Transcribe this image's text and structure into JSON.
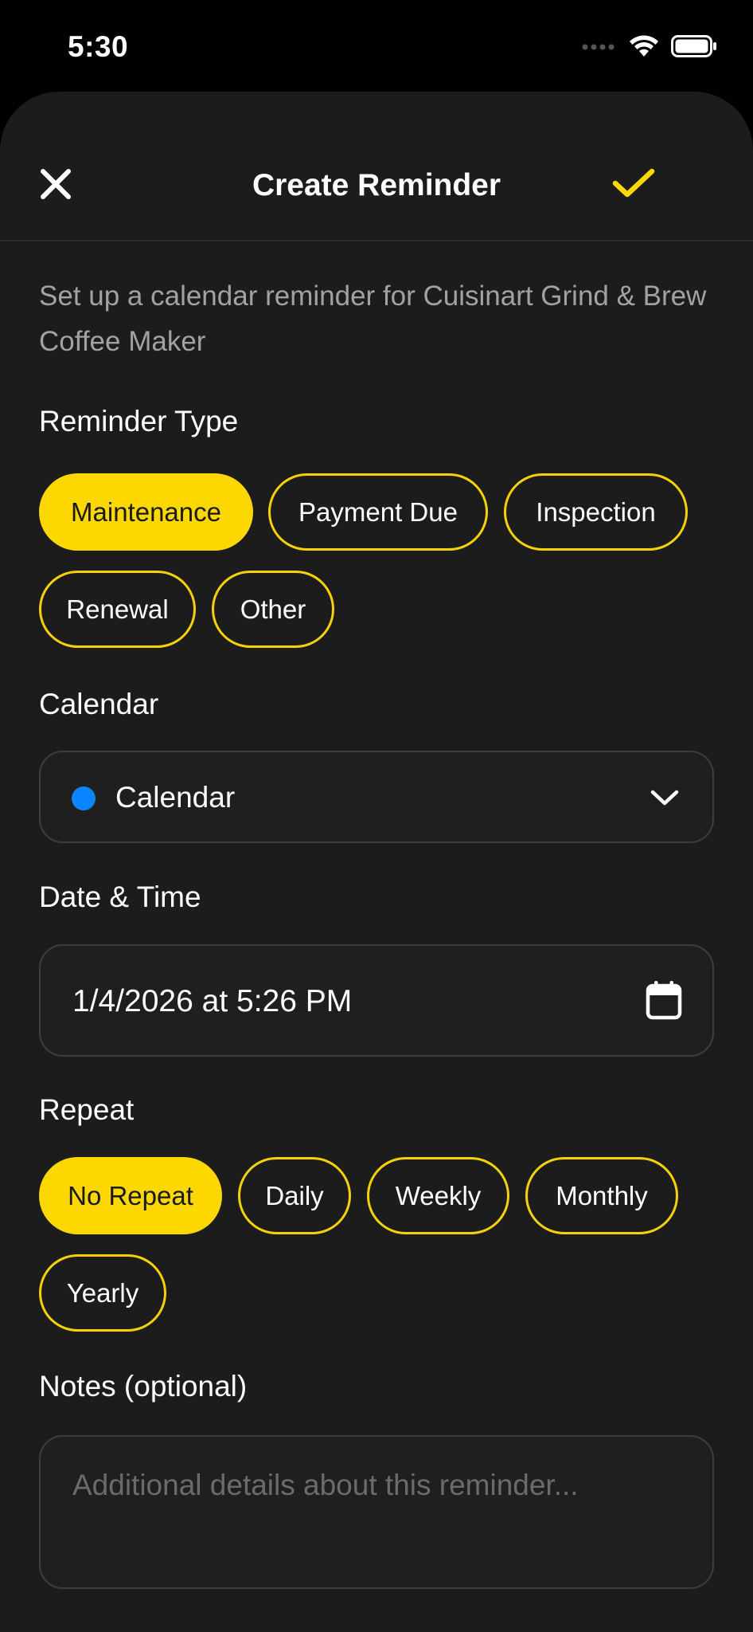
{
  "status_bar": {
    "time": "5:30"
  },
  "header": {
    "title": "Create Reminder",
    "close_icon": "close-icon",
    "confirm_icon": "checkmark-icon"
  },
  "subtitle": "Set up a calendar reminder for Cuisinart Grind & Brew Coffee Maker",
  "reminder_type": {
    "label": "Reminder Type",
    "options": [
      "Maintenance",
      "Payment Due",
      "Inspection",
      "Renewal",
      "Other"
    ],
    "selected": "Maintenance"
  },
  "calendar": {
    "label": "Calendar",
    "value": "Calendar",
    "dot_color": "#0a84ff"
  },
  "date_time": {
    "label": "Date & Time",
    "value": "1/4/2026 at 5:26 PM"
  },
  "repeat": {
    "label": "Repeat",
    "options": [
      "No Repeat",
      "Daily",
      "Weekly",
      "Monthly",
      "Yearly"
    ],
    "selected": "No Repeat"
  },
  "notes": {
    "label": "Notes (optional)",
    "placeholder": "Additional details about this reminder..."
  },
  "colors": {
    "accent": "#fcd800",
    "background": "#1c1c1c",
    "calendar_blue": "#0a84ff"
  }
}
